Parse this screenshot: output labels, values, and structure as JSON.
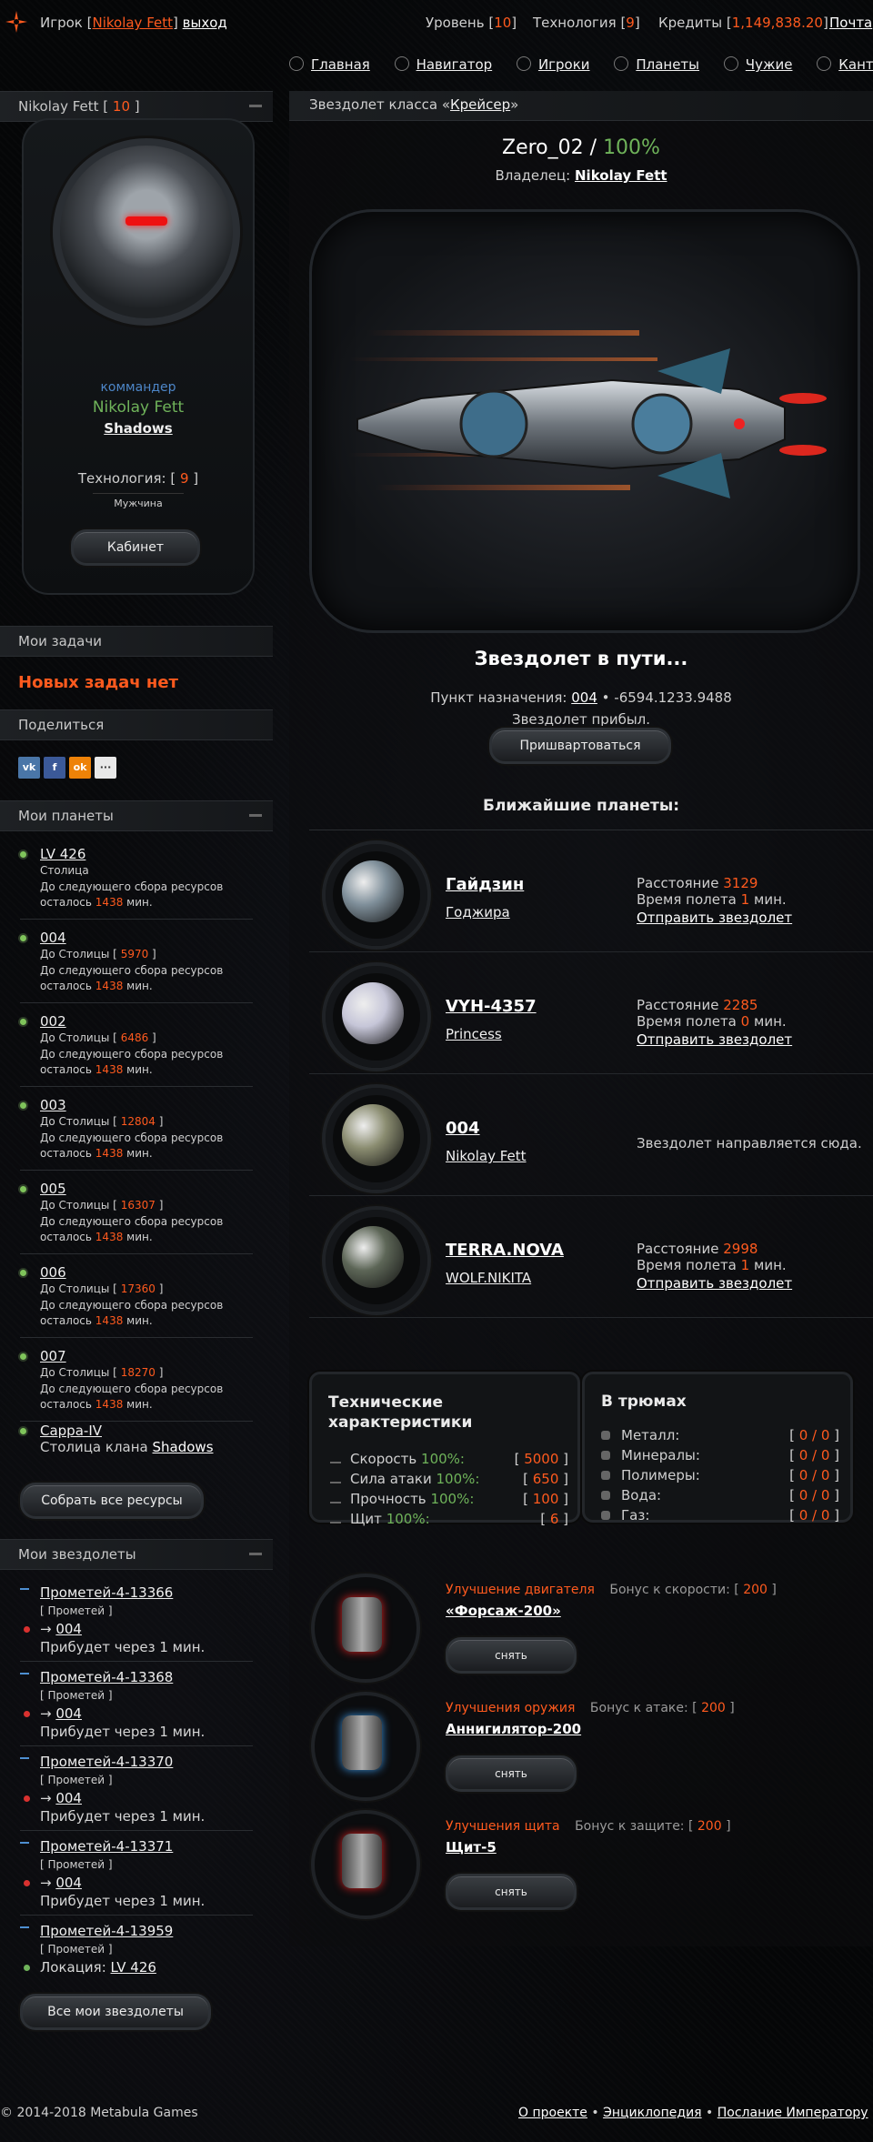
{
  "topbar": {
    "player_prefix": "Игрок [",
    "player_name": "Nikolay Fett",
    "player_suffix": "]",
    "logout": "выход",
    "level_label": "Уровень [",
    "level_value": "10",
    "tech_label": "Технология [",
    "tech_value": "9",
    "credits_label": "Кредиты [",
    "credits_value": "1,149,838.20",
    "close_bracket": "]",
    "mail": "Почта"
  },
  "nav": [
    "Главная",
    "Навигатор",
    "Игроки",
    "Планеты",
    "Чужие",
    "Кантина"
  ],
  "profile": {
    "header_name": "Nikolay Fett",
    "header_level": "10",
    "rank": "коммандер",
    "name": "Nikolay Fett",
    "clan": "Shadows",
    "tech_label": "Технология: [",
    "tech_value": "9",
    "close": "]",
    "gender": "Мужчина",
    "cabinet": "Кабинет"
  },
  "tasks": {
    "header": "Мои задачи",
    "empty": "Новых задач нет"
  },
  "share": {
    "header": "Поделиться",
    "buttons": [
      {
        "label": "vk",
        "color": "#4a76a8"
      },
      {
        "label": "f",
        "color": "#3b5998"
      },
      {
        "label": "ok",
        "color": "#ee8208"
      },
      {
        "label": "···",
        "color": "#e8e8e8"
      }
    ]
  },
  "my_planets": {
    "header": "Мои планеты",
    "capital_label": "Столица",
    "dist_label": "До Столицы [",
    "collect_label": "До следующего сбора ресурсов",
    "left_label": "осталось",
    "minutes": "мин.",
    "items": [
      {
        "name": "LV 426",
        "dist": "",
        "left": "1438"
      },
      {
        "name": "004",
        "dist": "5970",
        "left": "1438"
      },
      {
        "name": "002",
        "dist": "6486",
        "left": "1438"
      },
      {
        "name": "003",
        "dist": "12804",
        "left": "1438"
      },
      {
        "name": "005",
        "dist": "16307",
        "left": "1438"
      },
      {
        "name": "006",
        "dist": "17360",
        "left": "1438"
      },
      {
        "name": "007",
        "dist": "18270",
        "left": "1438"
      }
    ],
    "clan_planet": {
      "name": "Cappa-IV",
      "label": "Столица клана",
      "clan": "Shadows"
    },
    "collect_all": "Собрать все ресурсы"
  },
  "my_ships": {
    "header": "Мои звездолеты",
    "class_label": "[ Прометей ]",
    "arrive_label": "Прибудет через 1 мин.",
    "location_label": "Локация:",
    "items": [
      {
        "name": "Прометей-4-13366",
        "dest": "004"
      },
      {
        "name": "Прометей-4-13368",
        "dest": "004"
      },
      {
        "name": "Прометей-4-13370",
        "dest": "004"
      },
      {
        "name": "Прометей-4-13371",
        "dest": "004"
      },
      {
        "name": "Прометей-4-13959",
        "location": "LV 426"
      }
    ],
    "all_ships": "Все мои звездолеты"
  },
  "ship": {
    "class_prefix": "Звездолет класса «",
    "class_name": "Крейсер",
    "class_suffix": "»",
    "name": "Zero_02",
    "slash": "/",
    "condition": "100%",
    "owner_label": "Владелец:",
    "owner": "Nikolay Fett",
    "status_title": "Звездолет в пути...",
    "dest_label": "Пункт назначения:",
    "dest_name": "004",
    "dest_coords": "• -6594.1233.9488",
    "arrived": "Звездолет прибыл.",
    "dock_button": "Пришвартоваться",
    "nearest_title": "Ближайшие планеты:"
  },
  "nearest_planets": {
    "distance_label": "Расстояние",
    "flight_label": "Время полета",
    "minutes": "мин.",
    "send_label": "Отправить звездолет",
    "items": [
      {
        "name": "Гайдзин",
        "owner": "Годжира",
        "distance": "3129",
        "time": "1",
        "color": "#7f8f9a"
      },
      {
        "name": "VYH-4357",
        "owner": "Princess",
        "distance": "2285",
        "time": "0",
        "color": "#c6c6d8"
      },
      {
        "name": "004",
        "owner": "Nikolay Fett",
        "note": "Звездолет направляется сюда.",
        "color": "#8a8c70"
      },
      {
        "name": "TERRA.NOVA",
        "owner": "WOLF.NIKITA",
        "distance": "2998",
        "time": "1",
        "color": "#5d6657"
      }
    ]
  },
  "specs": {
    "title": "Технические характеристики",
    "rows": [
      {
        "label": "Скорость",
        "pct": "100%:",
        "value": "5000"
      },
      {
        "label": "Сила атаки",
        "pct": "100%:",
        "value": "650"
      },
      {
        "label": "Прочность",
        "pct": "100%:",
        "value": "100"
      },
      {
        "label": "Щит",
        "pct": "100%:",
        "value": "6"
      }
    ]
  },
  "cargo": {
    "title": "В трюмах",
    "rows": [
      {
        "label": "Металл:",
        "value": "0 / 0"
      },
      {
        "label": "Минералы:",
        "value": "0 / 0"
      },
      {
        "label": "Полимеры:",
        "value": "0 / 0"
      },
      {
        "label": "Вода:",
        "value": "0 / 0"
      },
      {
        "label": "Газ:",
        "value": "0 / 0"
      }
    ]
  },
  "upgrades": {
    "remove_label": "снять",
    "items": [
      {
        "kind": "Улучшение двигателя",
        "bonus_label": "Бонус к скорости: [",
        "bonus": "200",
        "name": "«Форсаж-200»"
      },
      {
        "kind": "Улучшения оружия",
        "bonus_label": "Бонус к атаке: [",
        "bonus": "200",
        "name": "Аннигилятор-200"
      },
      {
        "kind": "Улучшения щита",
        "bonus_label": "Бонус к защите: [",
        "bonus": "200",
        "name": "Щит-5"
      }
    ]
  },
  "footer": {
    "copyright": "© 2014-2018 Metabula Games",
    "links": [
      "О проекте",
      "Энциклопедия",
      "Послание Императору"
    ]
  }
}
